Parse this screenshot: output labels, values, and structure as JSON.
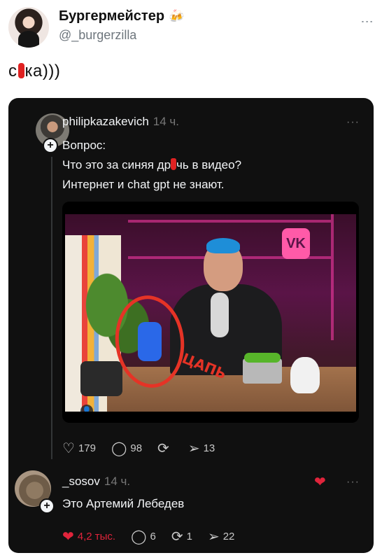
{
  "outer": {
    "author_name": "Бургермейстер",
    "author_badge": "🍻",
    "author_handle": "@_burgerzilla",
    "more": "⋮",
    "text_before": "с",
    "text_after": "ка)))"
  },
  "card": {
    "post": {
      "username": "philipkazakevich",
      "time": "14 ч.",
      "more": "···",
      "line1": "Вопрос:",
      "line2_before": "Что это за синяя др",
      "line2_after": "чь в видео?",
      "line3": "Интернет и chat gpt не знают.",
      "video_annotation": "ЦАПЬ",
      "video_logo": "VK",
      "user_tag_icon": "👤",
      "likes": "179",
      "replies": "98",
      "reposts": "",
      "shares": "13"
    },
    "reply": {
      "username": "_sosov",
      "time": "14 ч.",
      "more": "···",
      "text": "Это Артемий Лебедев",
      "likes": "4,2 тыс.",
      "replies": "6",
      "reposts": "1",
      "shares": "22"
    }
  },
  "icons": {
    "heart_outline": "♡",
    "heart_filled": "❤",
    "comment": "◯",
    "repost": "⟳",
    "share": "➢",
    "plus": "+"
  },
  "colors": {
    "card_bg": "#101010",
    "like_red": "#e0243b",
    "annotation_red": "#e53326"
  }
}
